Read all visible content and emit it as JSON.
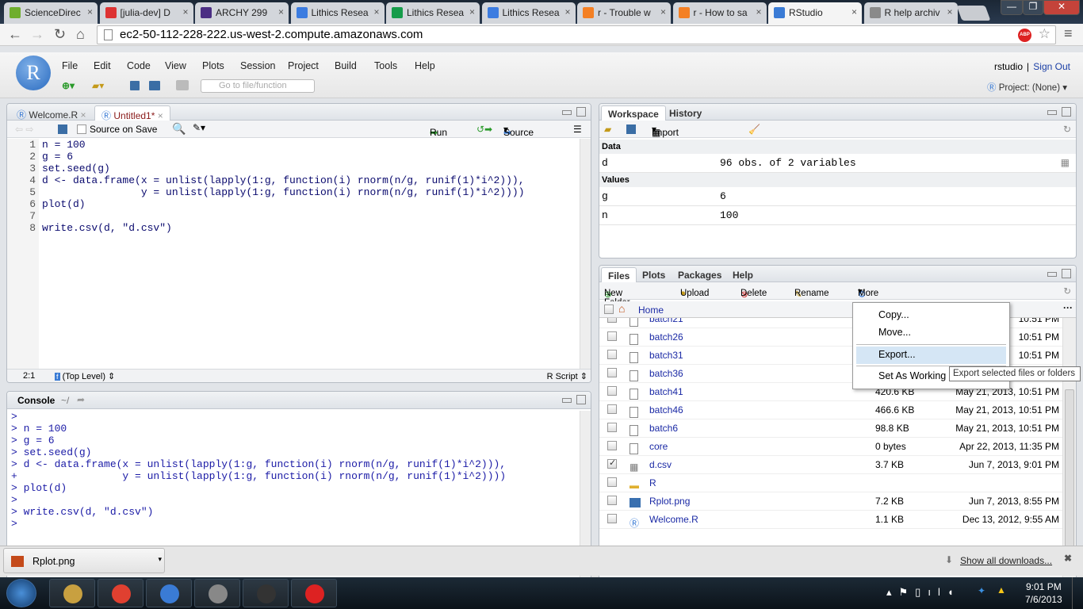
{
  "browser": {
    "tabs": [
      {
        "title": "ScienceDirec",
        "icon": "sciencedirect-icon",
        "color": "#6fae2d"
      },
      {
        "title": "[julia-dev] D",
        "icon": "gmail-icon",
        "color": "#d33"
      },
      {
        "title": "ARCHY 299",
        "icon": "uw-icon",
        "color": "#4b2e83"
      },
      {
        "title": "Lithics Resea",
        "icon": "google-docs-icon",
        "color": "#3c7ce0"
      },
      {
        "title": "Lithics Resea",
        "icon": "google-sheets-icon",
        "color": "#169c4a"
      },
      {
        "title": "Lithics Resea",
        "icon": "google-docs-icon",
        "color": "#3c7ce0"
      },
      {
        "title": "r - Trouble w",
        "icon": "stackoverflow-icon",
        "color": "#f48024"
      },
      {
        "title": "r - How to sa",
        "icon": "stackoverflow-icon",
        "color": "#f48024"
      },
      {
        "title": "RStudio",
        "icon": "rstudio-icon",
        "color": "#3a7bd5"
      },
      {
        "title": "R help archiv",
        "icon": "r-icon",
        "color": "#8a8a8a"
      }
    ],
    "active_tab": 8,
    "url": "ec2-50-112-228-222.us-west-2.compute.amazonaws.com",
    "abp": "ABP"
  },
  "rstudio": {
    "logo": "R",
    "menu": [
      "File",
      "Edit",
      "Code",
      "View",
      "Plots",
      "Session",
      "Project",
      "Build",
      "Tools",
      "Help"
    ],
    "user": "rstudio",
    "sign_out": "Sign Out",
    "goto_placeholder": "Go to file/function",
    "project": "Project: (None)",
    "editor": {
      "tabs": [
        "Welcome.R",
        "Untitled1*"
      ],
      "source_on_save": "Source on Save",
      "run": "Run",
      "source": "Source",
      "lines": [
        "n = 100",
        "g = 6",
        "set.seed(g)",
        "d <- data.frame(x = unlist(lapply(1:g, function(i) rnorm(n/g, runif(1)*i^2))),",
        "                y = unlist(lapply(1:g, function(i) rnorm(n/g, runif(1)*i^2))))",
        "plot(d)",
        "",
        "write.csv(d, \"d.csv\")"
      ],
      "line_numbers": [
        "1",
        "2",
        "3",
        "4",
        "5",
        "6",
        "7",
        "8"
      ],
      "cursor": "2:1",
      "scope": "(Top Level)",
      "filetype": "R Script"
    },
    "console": {
      "title": "Console",
      "path": "~/",
      "lines": [
        ">",
        "> n = 100",
        "> g = 6",
        "> set.seed(g)",
        "> d <- data.frame(x = unlist(lapply(1:g, function(i) rnorm(n/g, runif(1)*i^2))),",
        "+                 y = unlist(lapply(1:g, function(i) rnorm(n/g, runif(1)*i^2))))",
        "> plot(d)",
        ">",
        "> write.csv(d, \"d.csv\")",
        "> "
      ]
    },
    "workspace": {
      "tabs": [
        "Workspace",
        "History"
      ],
      "import": "Import Dataset",
      "data_header": "Data",
      "data": [
        {
          "name": "d",
          "value": "96 obs. of 2 variables"
        }
      ],
      "values_header": "Values",
      "values": [
        {
          "name": "g",
          "value": "6"
        },
        {
          "name": "n",
          "value": "100"
        }
      ]
    },
    "files": {
      "tabs": [
        "Files",
        "Plots",
        "Packages",
        "Help"
      ],
      "toolbar": {
        "new_folder": "New Folder",
        "upload": "Upload",
        "delete": "Delete",
        "rename": "Rename",
        "more": "More"
      },
      "breadcrumb": "Home",
      "rows": [
        {
          "name": "batch21",
          "size": "",
          "modified": "10:51 PM",
          "type": "file",
          "checked": false
        },
        {
          "name": "batch26",
          "size": "",
          "modified": "10:51 PM",
          "type": "file",
          "checked": false
        },
        {
          "name": "batch31",
          "size": "",
          "modified": "10:51 PM",
          "type": "file",
          "checked": false
        },
        {
          "name": "batch36",
          "size": "",
          "modified": "",
          "type": "file",
          "checked": false
        },
        {
          "name": "batch41",
          "size": "420.6 KB",
          "modified": "May 21, 2013, 10:51 PM",
          "type": "file",
          "checked": false
        },
        {
          "name": "batch46",
          "size": "466.6 KB",
          "modified": "May 21, 2013, 10:51 PM",
          "type": "file",
          "checked": false
        },
        {
          "name": "batch6",
          "size": "98.8 KB",
          "modified": "May 21, 2013, 10:51 PM",
          "type": "file",
          "checked": false
        },
        {
          "name": "core",
          "size": "0 bytes",
          "modified": "Apr 22, 2013, 11:35 PM",
          "type": "file",
          "checked": false
        },
        {
          "name": "d.csv",
          "size": "3.7 KB",
          "modified": "Jun 7, 2013, 9:01 PM",
          "type": "csv",
          "checked": true
        },
        {
          "name": "R",
          "size": "",
          "modified": "",
          "type": "folder",
          "checked": false
        },
        {
          "name": "Rplot.png",
          "size": "7.2 KB",
          "modified": "Jun 7, 2013, 8:55 PM",
          "type": "image",
          "checked": false
        },
        {
          "name": "Welcome.R",
          "size": "1.1 KB",
          "modified": "Dec 13, 2012, 9:55 AM",
          "type": "rfile",
          "checked": false
        }
      ],
      "more_menu": [
        "Copy...",
        "Move...",
        "Export...",
        "Set As Working"
      ],
      "highlighted": "Export...",
      "tooltip": "Export selected files or folders"
    }
  },
  "downloads": {
    "file": "Rplot.png",
    "show_all": "Show all downloads..."
  },
  "taskbar": {
    "apps": [
      "explorer-icon",
      "chrome-icon",
      "rstudio-icon",
      "security-icon",
      "inkscape-icon",
      "paint-icon"
    ],
    "time": "9:01 PM",
    "date": "7/6/2013"
  }
}
